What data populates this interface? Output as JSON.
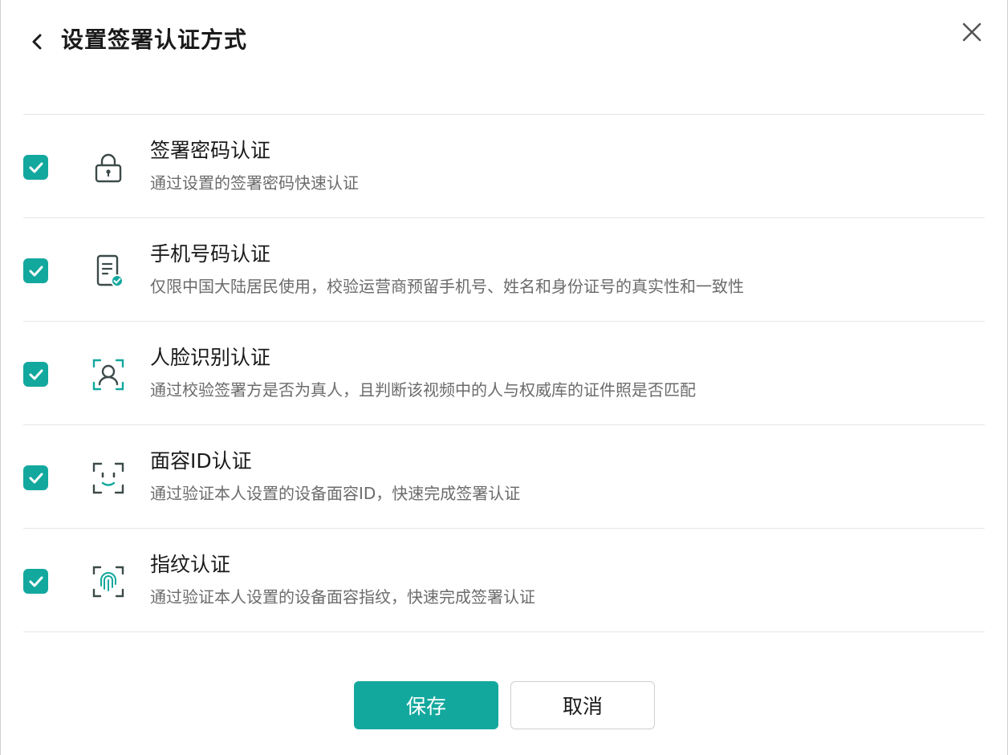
{
  "header": {
    "title": "设置签署认证方式"
  },
  "colors": {
    "accent": "#13a89e",
    "icon_stroke": "#3d4a4a"
  },
  "methods": [
    {
      "icon": "lock-icon",
      "title": "签署密码认证",
      "desc": "通过设置的签署密码快速认证",
      "checked": true
    },
    {
      "icon": "phone-verify-icon",
      "title": "手机号码认证",
      "desc": "仅限中国大陆居民使用，校验运营商预留手机号、姓名和身份证号的真实性和一致性",
      "checked": true
    },
    {
      "icon": "face-scan-icon",
      "title": "人脸识别认证",
      "desc": "通过校验签署方是否为真人，且判断该视频中的人与权威库的证件照是否匹配",
      "checked": true
    },
    {
      "icon": "face-id-icon",
      "title": "面容ID认证",
      "desc": "通过验证本人设置的设备面容ID，快速完成签署认证",
      "checked": true
    },
    {
      "icon": "fingerprint-icon",
      "title": "指纹认证",
      "desc": "通过验证本人设置的设备面容指纹，快速完成签署认证",
      "checked": true
    }
  ],
  "footer": {
    "save_label": "保存",
    "cancel_label": "取消"
  }
}
